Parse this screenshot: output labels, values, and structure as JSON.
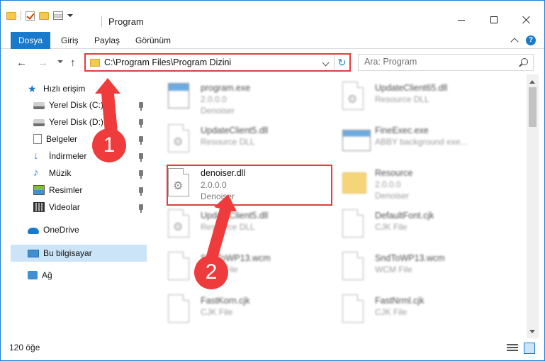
{
  "window": {
    "title": "Program",
    "buttons": {
      "minimize": "minimize-icon",
      "maximize": "maximize-icon",
      "close": "close-icon"
    }
  },
  "ribbon": {
    "tabs": [
      "Dosya",
      "Giriş",
      "Paylaş",
      "Görünüm"
    ]
  },
  "nav": {
    "address": "C:\\Program Files\\Program Dizini",
    "search_placeholder": "Ara: Program"
  },
  "sidebar": {
    "items": [
      {
        "label": "Hızlı erişim",
        "icon": "star-icon"
      },
      {
        "label": "Yerel Disk (C:)",
        "icon": "drive-icon"
      },
      {
        "label": "Yerel Disk (D:)",
        "icon": "drive-icon"
      },
      {
        "label": "Belgeler",
        "icon": "documents-icon"
      },
      {
        "label": "İndirmeler",
        "icon": "download-icon"
      },
      {
        "label": "Müzik",
        "icon": "music-icon"
      },
      {
        "label": "Resimler",
        "icon": "pictures-icon"
      },
      {
        "label": "Videolar",
        "icon": "video-icon"
      },
      {
        "label": "OneDrive",
        "icon": "cloud-icon"
      },
      {
        "label": "Bu bilgisayar",
        "icon": "computer-icon"
      },
      {
        "label": "Ağ",
        "icon": "network-icon"
      }
    ]
  },
  "files": [
    {
      "name": "program.exe",
      "line2": "2.0.0.0",
      "line3": "Denoiser"
    },
    {
      "name": "UpdateClient65.dll",
      "line2": "Resource DLL",
      "line3": ""
    },
    {
      "name": "UpdateClient5.dll",
      "line2": "Resource DLL",
      "line3": ""
    },
    {
      "name": "FineExec.exe",
      "line2": "ABBY background exe...",
      "line3": ""
    },
    {
      "name": "Resource",
      "line2": "2.0.0.0",
      "line3": "Denoiser"
    },
    {
      "name": "UpdateClient5.dll",
      "line2": "Resource DLL",
      "line3": ""
    },
    {
      "name": "DefaultFont.cjk",
      "line2": "CJK File",
      "line3": ""
    },
    {
      "name": "SndToWP13.wcm",
      "line2": "WCM File",
      "line3": ""
    },
    {
      "name": "SndToWP13.wcm",
      "line2": "WCM File",
      "line3": ""
    },
    {
      "name": "FastKorn.cjk",
      "line2": "CJK File",
      "line3": ""
    },
    {
      "name": "FastNrml.cjk",
      "line2": "CJK File",
      "line3": ""
    }
  ],
  "selected_file": {
    "name": "denoiser.dll",
    "version": "2.0.0.0",
    "description": "Denoiser"
  },
  "status": {
    "count": "120 öğe"
  },
  "annotations": {
    "step1": "1",
    "step2": "2",
    "color": "#ef3b3b"
  }
}
